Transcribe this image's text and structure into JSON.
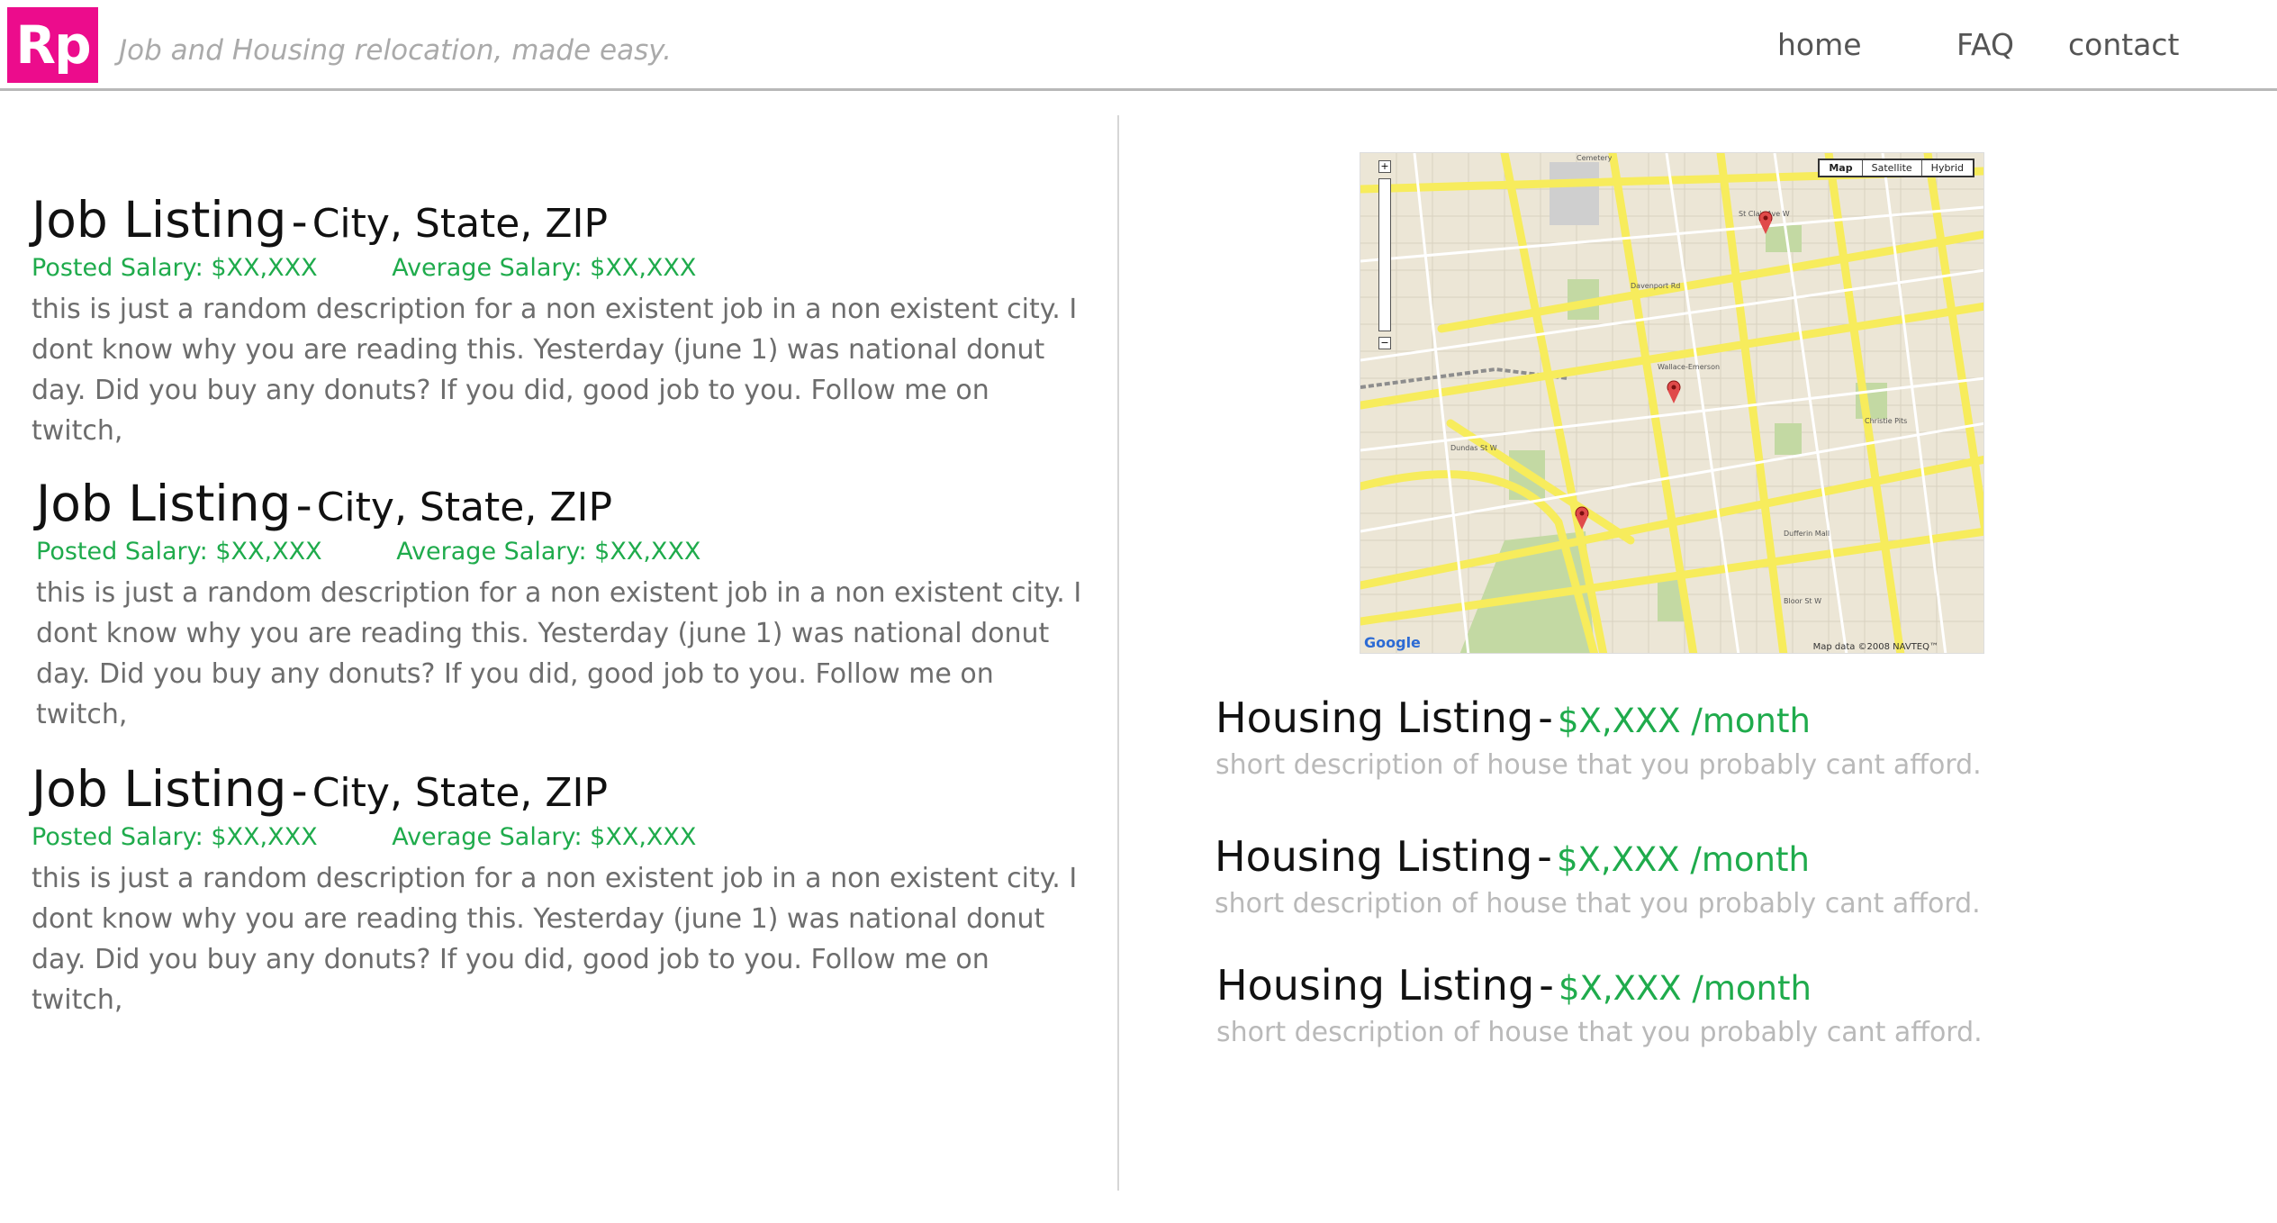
{
  "header": {
    "logo_text": "Rp",
    "tagline": "Job and Housing relocation, made easy.",
    "nav": [
      "home",
      "FAQ",
      "contact"
    ]
  },
  "jobs": [
    {
      "title": "Job Listing",
      "separator": "-",
      "location": "City, State, ZIP",
      "posted_salary": "Posted Salary: $XX,XXX",
      "average_salary": "Average Salary: $XX,XXX",
      "description": "this is just a random description for a non existent job in a non existent city. I dont know why you are reading this. Yesterday (june 1) was national donut day. Did you buy any donuts? If you did, good job to you. Follow me on twitch,"
    },
    {
      "title": "Job Listing",
      "separator": "-",
      "location": "City, State, ZIP",
      "posted_salary": "Posted Salary: $XX,XXX",
      "average_salary": "Average Salary: $XX,XXX",
      "description": "this is just a random description for a non existent job in a non existent city. I dont know why you are reading this. Yesterday (june 1) was national donut day. Did you buy any donuts? If you did, good job to you. Follow me on twitch,"
    },
    {
      "title": "Job Listing",
      "separator": "-",
      "location": "City, State, ZIP",
      "posted_salary": "Posted Salary: $XX,XXX",
      "average_salary": "Average Salary: $XX,XXX",
      "description": "this is just a random description for a non existent job in a non existent city. I dont know why you are reading this. Yesterday (june 1) was national donut day. Did you buy any donuts? If you did, good job to you. Follow me on twitch,"
    }
  ],
  "map": {
    "controls": [
      "Map",
      "Satellite",
      "Hybrid"
    ],
    "zoom_in": "+",
    "zoom_out": "−",
    "brand": "Google",
    "credit": "Map data ©2008 NAVTEQ™"
  },
  "housing": [
    {
      "title": "Housing Listing",
      "separator": "-",
      "price": "$X,XXX /month",
      "description": "short description of house that you probably cant afford."
    },
    {
      "title": "Housing Listing",
      "separator": "-",
      "price": "$X,XXX /month",
      "description": "short description of house that you probably cant afford."
    },
    {
      "title": "Housing Listing",
      "separator": "-",
      "price": "$X,XXX /month",
      "description": "short description of house that you probably cant afford."
    }
  ],
  "colors": {
    "brand": "#ec0c8c",
    "salary_green": "#1fab4c",
    "road_yellow": "#f7ec5c",
    "park_green": "#c3d9a3"
  },
  "icons": [
    "map-pin-icon",
    "zoom-in-icon",
    "zoom-out-icon"
  ]
}
